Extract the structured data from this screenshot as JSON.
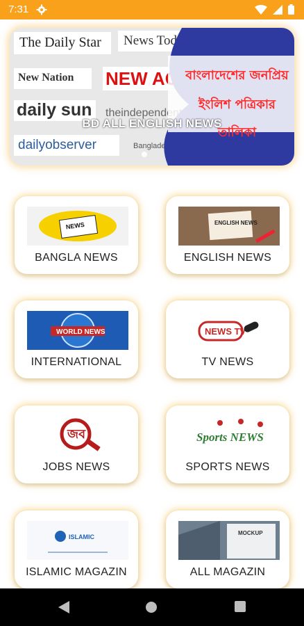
{
  "status_bar": {
    "time": "7:31",
    "icons": [
      "gear-icon",
      "wifi-icon",
      "signal-icon",
      "battery-icon"
    ]
  },
  "banner": {
    "title": "BD ALL ENGLISH NEWS",
    "logos": [
      "The Daily Star",
      "News Today",
      "New Nation",
      "NEW AGE",
      "daily sun",
      "theindependent",
      "dailyobserver",
      "Bangladesh Post"
    ],
    "bengali_lines": [
      "বাংলাদেশের জনপ্রিয়",
      "ইংলিশ পত্রিকার",
      "তালিকা"
    ]
  },
  "categories": [
    {
      "label": "BANGLA NEWS",
      "icon": "newspaper-icon",
      "image_text": "NEWS"
    },
    {
      "label": "ENGLISH NEWS",
      "icon": "english-news-icon",
      "image_text": "ENGLISH NEWS"
    },
    {
      "label": "INTERNATIONAL",
      "icon": "world-news-icon",
      "image_text": "WORLD NEWS"
    },
    {
      "label": "TV NEWS",
      "icon": "tv-news-icon",
      "image_text": "NEWS TV"
    },
    {
      "label": "JOBS NEWS",
      "icon": "jobs-icon",
      "image_text": "জব"
    },
    {
      "label": "SPORTS NEWS",
      "icon": "sports-icon",
      "image_text": "Sports NEWS"
    },
    {
      "label": "ISLAMIC MAGAZIN",
      "icon": "islamic-icon",
      "image_text": "ISLAMIC"
    },
    {
      "label": "ALL MAGAZIN",
      "icon": "magazine-icon",
      "image_text": "MOCKUP"
    }
  ],
  "colors": {
    "status_bar": "#f9a11b",
    "card_glow": "#f5be46",
    "navbar": "#000000"
  },
  "nav_buttons": [
    "back-icon",
    "home-icon",
    "recents-icon"
  ]
}
